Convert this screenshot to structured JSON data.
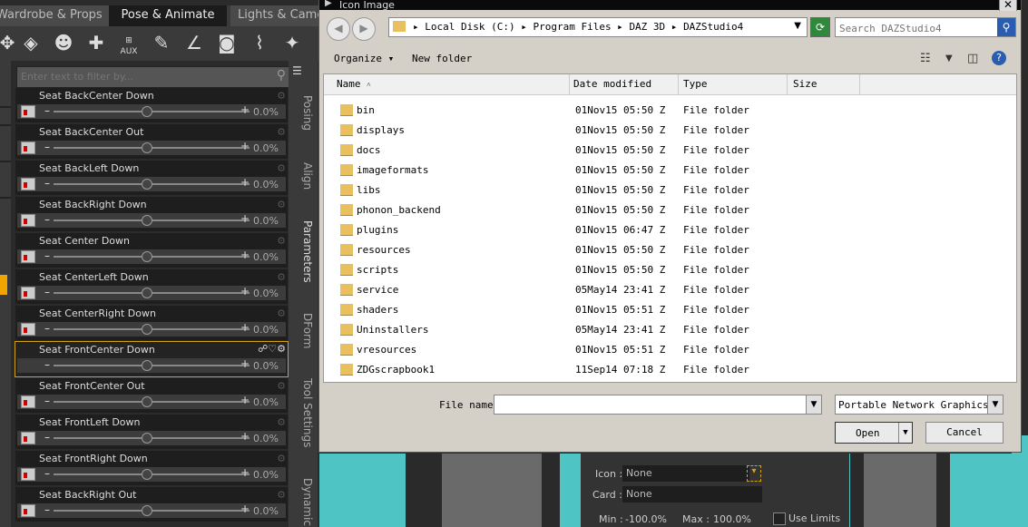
{
  "app": {
    "tabs": [
      "Wardrobe & Props",
      "Pose & Animate",
      "Lights & Camer"
    ],
    "filter_placeholder": "Enter text to filter by...",
    "side_tabs": [
      "Posing",
      "Align",
      "Parameters",
      "DForm",
      "Tool Settings",
      "Dynamic"
    ],
    "tool_aux_label": "AUX",
    "parameters": [
      {
        "name": "Seat BackCenter Down",
        "value": "0.0%"
      },
      {
        "name": "Seat BackCenter Out",
        "value": "0.0%"
      },
      {
        "name": "Seat BackLeft Down",
        "value": "0.0%"
      },
      {
        "name": "Seat BackRight Down",
        "value": "0.0%"
      },
      {
        "name": "Seat Center Down",
        "value": "0.0%"
      },
      {
        "name": "Seat CenterLeft Down",
        "value": "0.0%"
      },
      {
        "name": "Seat CenterRight Down",
        "value": "0.0%"
      },
      {
        "name": "Seat FrontCenter Down",
        "value": "0.0%",
        "selected": true
      },
      {
        "name": "Seat FrontCenter Out",
        "value": "0.0%"
      },
      {
        "name": "Seat FrontLeft Down",
        "value": "0.0%"
      },
      {
        "name": "Seat FrontRight Down",
        "value": "0.0%"
      },
      {
        "name": "Seat BackRight Out",
        "value": "0.0%"
      }
    ],
    "property_panel": {
      "icon_label": "Icon :",
      "icon_value": "None",
      "card_label": "Card :",
      "card_value": "None",
      "min_label": "Min :",
      "min_value": "-100.0%",
      "max_label": "Max :",
      "max_value": "100.0%",
      "use_limits_label": "Use Limits"
    },
    "selection_color": "#d4a017"
  },
  "dialog": {
    "title": "Icon Image",
    "breadcrumbs": [
      "Local Disk (C:)",
      "Program Files",
      "DAZ 3D",
      "DAZStudio4"
    ],
    "search_placeholder": "Search DAZStudio4",
    "toolbar": {
      "organize": "Organize",
      "new_folder": "New folder"
    },
    "columns": [
      "Name",
      "Date modified",
      "Type",
      "Size"
    ],
    "files": [
      {
        "name": "bin",
        "date": "01Nov15 05:50 Z",
        "type": "File folder"
      },
      {
        "name": "displays",
        "date": "01Nov15 05:50 Z",
        "type": "File folder"
      },
      {
        "name": "docs",
        "date": "01Nov15 05:50 Z",
        "type": "File folder"
      },
      {
        "name": "imageformats",
        "date": "01Nov15 05:50 Z",
        "type": "File folder"
      },
      {
        "name": "libs",
        "date": "01Nov15 05:50 Z",
        "type": "File folder"
      },
      {
        "name": "phonon_backend",
        "date": "01Nov15 05:50 Z",
        "type": "File folder"
      },
      {
        "name": "plugins",
        "date": "01Nov15 06:47 Z",
        "type": "File folder"
      },
      {
        "name": "resources",
        "date": "01Nov15 05:50 Z",
        "type": "File folder"
      },
      {
        "name": "scripts",
        "date": "01Nov15 05:50 Z",
        "type": "File folder"
      },
      {
        "name": "service",
        "date": "05May14 23:41 Z",
        "type": "File folder"
      },
      {
        "name": "shaders",
        "date": "01Nov15 05:51 Z",
        "type": "File folder"
      },
      {
        "name": "Uninstallers",
        "date": "05May14 23:41 Z",
        "type": "File folder"
      },
      {
        "name": "vresources",
        "date": "01Nov15 05:51 Z",
        "type": "File folder"
      },
      {
        "name": "ZDGscrapbook1",
        "date": "11Sep14 07:18 Z",
        "type": "File folder"
      }
    ],
    "file_name_label": "File name:",
    "file_name_value": "",
    "file_type_value": "Portable Network Graphics (*.png)",
    "open_label": "Open",
    "cancel_label": "Cancel"
  }
}
